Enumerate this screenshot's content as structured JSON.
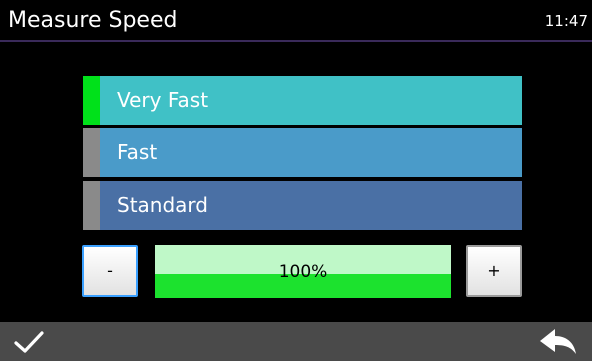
{
  "header": {
    "title": "Measure Speed",
    "time": "11:47"
  },
  "options": [
    {
      "label": "Very Fast",
      "selected": true,
      "bg": "#40c1c6",
      "marker": "#00e11a"
    },
    {
      "label": "Fast",
      "selected": false,
      "bg": "#4a9bc9",
      "marker": "#8a8a8a"
    },
    {
      "label": "Standard",
      "selected": false,
      "bg": "#4a70a5",
      "marker": "#8a8a8a"
    }
  ],
  "level": {
    "text": "100%",
    "fraction": 0.45
  },
  "controls": {
    "minus": "-",
    "plus": "+"
  },
  "footer": {
    "ok_icon": "checkmark-icon",
    "back_icon": "back-arrow-icon"
  }
}
